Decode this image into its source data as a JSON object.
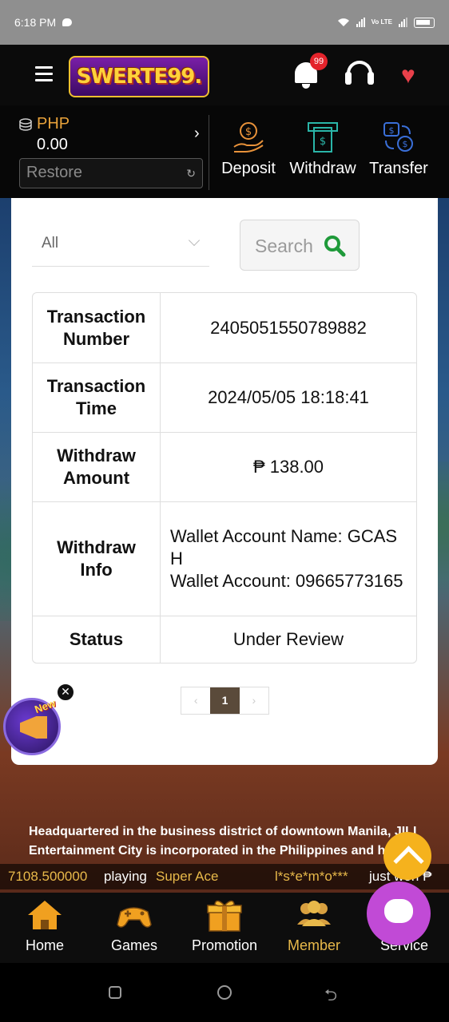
{
  "status_bar": {
    "time": "6:18 PM",
    "network": "Vo LTE"
  },
  "header": {
    "logo_text": "SWERTE99.",
    "notification_count": "99"
  },
  "wallet": {
    "currency": "PHP",
    "balance": "0.00",
    "restore_label": "Restore",
    "actions": [
      {
        "label": "Deposit",
        "icon": "deposit-hand-coin-icon"
      },
      {
        "label": "Withdraw",
        "icon": "withdraw-atm-icon"
      },
      {
        "label": "Transfer",
        "icon": "transfer-icon"
      }
    ]
  },
  "filter": {
    "selected": "All",
    "search_label": "Search"
  },
  "transaction": {
    "rows": [
      {
        "label": "Transaction Number",
        "value": "2405051550789882"
      },
      {
        "label": "Transaction Time",
        "value": "2024/05/05 18:18:41"
      },
      {
        "label": "Withdraw Amount",
        "value": "₱ 138.00"
      },
      {
        "label": "Withdraw Info",
        "value_line1": "Wallet Account Name: GCASH",
        "value_line2": "Wallet Account: 09665773165"
      },
      {
        "label": "Status",
        "value": "Under Review"
      }
    ]
  },
  "pagination": {
    "prev": "‹",
    "current": "1",
    "next": "›"
  },
  "promo": {
    "tag": "New"
  },
  "about_text": "Headquartered in the business district of downtown Manila, JILI Entertainment City is incorporated in the Philippines and h",
  "about_line1": "Headquartered in the business district of downtown Manila, JILI",
  "about_line2": "Entertainment City is incorporated in the Philippines and h",
  "ticker": {
    "amount": "7108.500000",
    "playing": "playing",
    "game": "Super Ace",
    "user": "l*s*e*m*o***",
    "won": "just won ₱"
  },
  "bottom_nav": [
    {
      "label": "Home",
      "icon": "home-icon"
    },
    {
      "label": "Games",
      "icon": "gamepad-icon"
    },
    {
      "label": "Promotion",
      "icon": "gift-icon"
    },
    {
      "label": "Member",
      "icon": "member-icon",
      "active": true
    },
    {
      "label": "Service",
      "icon": "service-icon"
    }
  ],
  "colors": {
    "accent": "#e8b94a",
    "header_bg": "#0b0b0b",
    "fab_chat": "#c14ad6",
    "fab_top": "#f5b21d"
  }
}
